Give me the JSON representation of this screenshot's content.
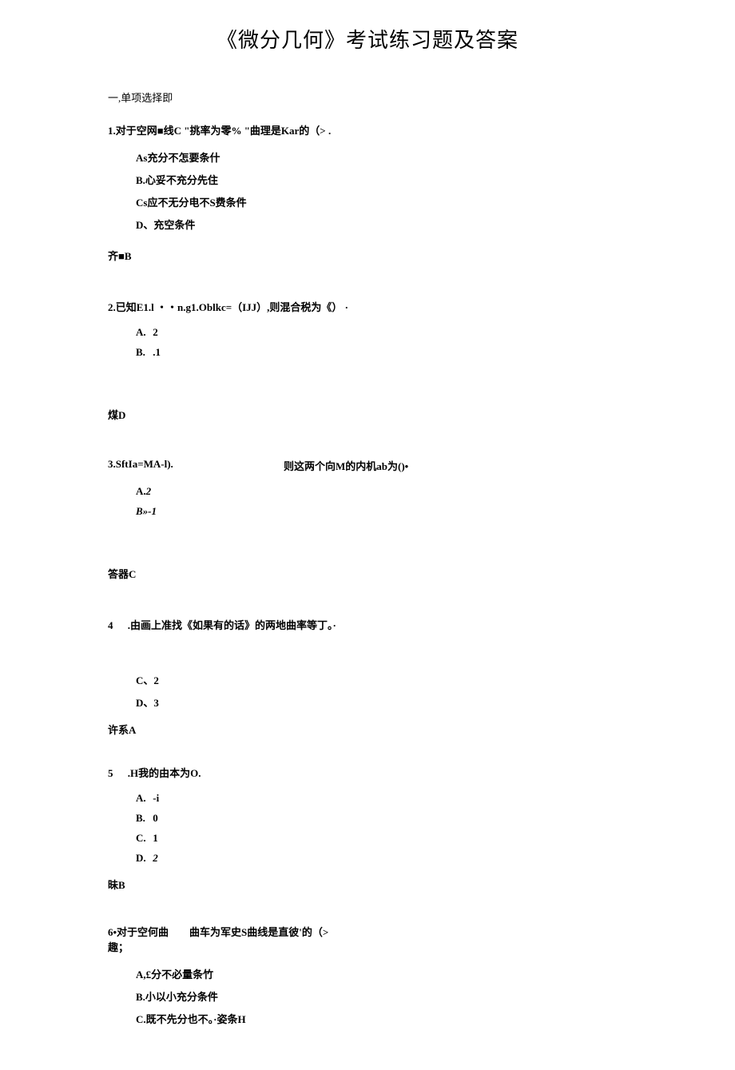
{
  "title": "《微分几何》考试练习题及答案",
  "section_heading": "一,单项选择即",
  "q1": {
    "text": "1.对于空网■线C \"挑率为零% \"曲理是Kar的（> .",
    "optA": "As充分不怎要条什",
    "optB": "B.心妥不充分先住",
    "optC": "Cs应不无分电不S费条件",
    "optD": "D、充空条件",
    "answer": "齐■B"
  },
  "q2": {
    "text": "2.已知E1.l ・・n.g1.Oblkc=（IJJ）,则混合税为《） ·",
    "labelA": "A.",
    "valA": "2",
    "labelB": "B.",
    "valB": ".1",
    "answer": "煤D"
  },
  "q3": {
    "left": "3.SftIa=MA-l).",
    "right": "则这两个向M的内机ab为()•",
    "labelA": "A.",
    "valA": "2",
    "optB": "B»-1",
    "answer": "答器C"
  },
  "q4": {
    "num": "4",
    "text": ".由画上准找《如果有的话》的两地曲率等丁。·",
    "optC": "C、2",
    "optD": "D、3",
    "answer": "许系A"
  },
  "q5": {
    "num": "5",
    "text": ".H我的由本为O.",
    "labelA": "A.",
    "valA": "-i",
    "labelB": "B.",
    "valB": "0",
    "labelC": "C.",
    "valC": "1",
    "labelD": "D.",
    "valD": "2",
    "answer": "昧B"
  },
  "q6": {
    "left": "6•对于空何曲趣；",
    "mid": "曲车为军史S曲线是直彼'的（>",
    "optA": "A,£分不必量条竹",
    "optB": "B.小以小充分条件",
    "optC": "C.既不先分也不。·姿条H"
  }
}
